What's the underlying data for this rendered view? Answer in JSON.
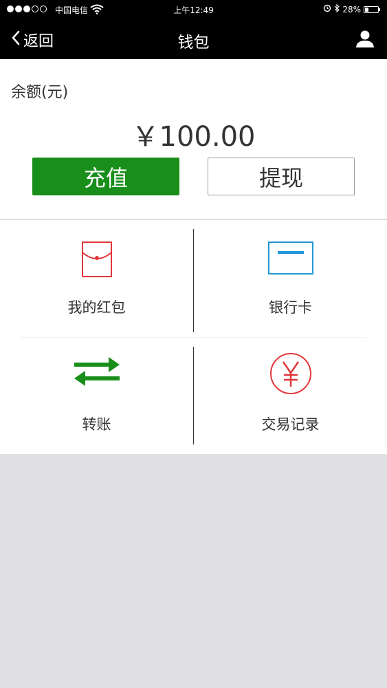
{
  "status_bar": {
    "carrier": "中国电信",
    "time": "上午12:49",
    "battery_percent": "28%",
    "signal_bars_filled": 3,
    "signal_bars_total": 5
  },
  "nav": {
    "back_label": "返回",
    "title": "钱包"
  },
  "balance": {
    "label": "余额(元)",
    "amount": "￥100.00"
  },
  "actions": {
    "recharge_label": "充值",
    "withdraw_label": "提现"
  },
  "menu": [
    {
      "label": "我的红包",
      "icon": "red-envelope-icon"
    },
    {
      "label": "银行卡",
      "icon": "bank-card-icon"
    },
    {
      "label": "转账",
      "icon": "transfer-arrows-icon"
    },
    {
      "label": "交易记录",
      "icon": "yuan-circle-icon"
    }
  ],
  "colors": {
    "nav_background": "#000000",
    "recharge_button": "#1a8e1a",
    "envelope_icon": "#e2363b",
    "bank_card_icon": "#2196d6",
    "transfer_icon": "#1a8e1a",
    "yuan_icon": "#e2363b",
    "page_background": "#e0dfe1"
  }
}
